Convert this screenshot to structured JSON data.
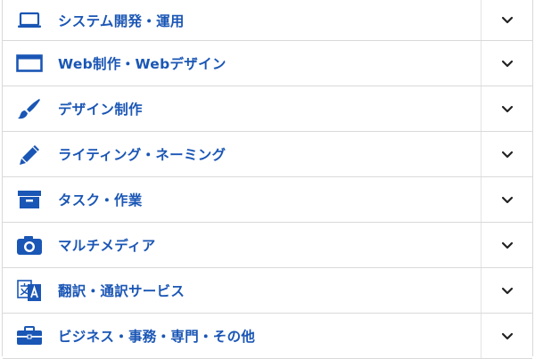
{
  "accent_color": "#1a56b5",
  "categories": [
    {
      "label": "システム開発・運用",
      "icon": "laptop-icon"
    },
    {
      "label": "Web制作・Webデザイン",
      "icon": "browser-window-icon"
    },
    {
      "label": "デザイン制作",
      "icon": "paintbrush-icon"
    },
    {
      "label": "ライティング・ネーミング",
      "icon": "pencil-icon"
    },
    {
      "label": "タスク・作業",
      "icon": "archive-box-icon"
    },
    {
      "label": "マルチメディア",
      "icon": "camera-icon"
    },
    {
      "label": "翻訳・通訳サービス",
      "icon": "translate-icon"
    },
    {
      "label": "ビジネス・事務・専門・その他",
      "icon": "briefcase-icon"
    }
  ]
}
